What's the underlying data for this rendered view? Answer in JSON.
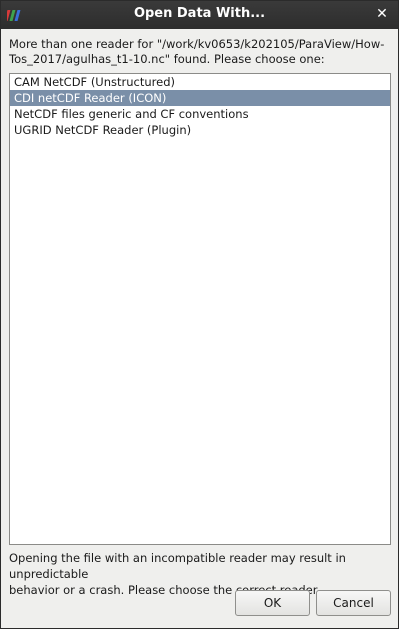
{
  "window": {
    "title": "Open Data With...",
    "close_glyph": "✕",
    "app_icon": "paraview-icon"
  },
  "message": {
    "line1": "More than one reader for \"/work/kv0653/k202105/ParaView/How-",
    "line2": "Tos_2017/agulhas_t1-10.nc\" found.  Please choose one:"
  },
  "readers": [
    {
      "label": "CAM NetCDF (Unstructured)",
      "selected": false
    },
    {
      "label": "CDI netCDF Reader (ICON)",
      "selected": true
    },
    {
      "label": "NetCDF files generic and CF conventions",
      "selected": false
    },
    {
      "label": "UGRID NetCDF Reader (Plugin)",
      "selected": false
    }
  ],
  "warning": {
    "line1": "Opening the file with an incompatible reader may result in unpredictable",
    "line2": "behavior or a crash.  Please choose the correct reader."
  },
  "buttons": {
    "ok": "OK",
    "cancel": "Cancel"
  },
  "colors": {
    "selection": "#7a8fa8",
    "titlebar": "#2d2d2d"
  }
}
